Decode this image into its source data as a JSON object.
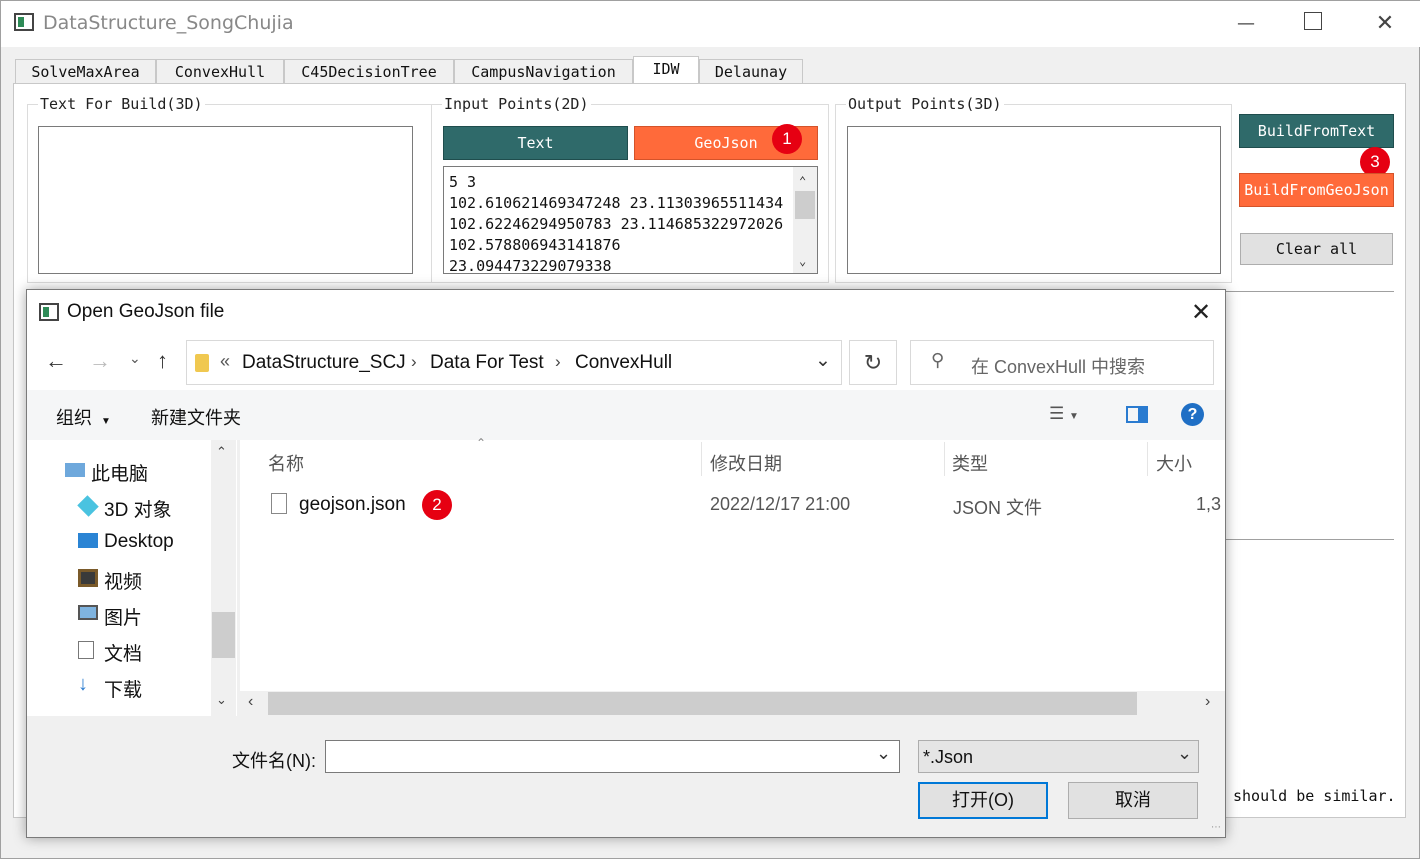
{
  "app": {
    "title": "DataStructure_SongChujia"
  },
  "tabs": [
    "SolveMaxArea",
    "ConvexHull",
    "C45DecisionTree",
    "CampusNavigation",
    "IDW",
    "Delaunay"
  ],
  "groups": {
    "build": "Text For Build(3D)",
    "input": "Input Points(2D)",
    "output": "Output Points(3D)"
  },
  "buttons": {
    "text": "Text",
    "geojson": "GeoJson",
    "build_text": "BuildFromText",
    "build_geojson": "BuildFromGeoJson",
    "clear_all": "Clear all"
  },
  "input_points": {
    "line1": "5 3",
    "line2": "102.610621469347248 23.11303965511434",
    "line3": "102.62246294950783 23.114685322972026",
    "line4": "102.578806943141876",
    "line5": "23.094473229079338"
  },
  "background_note": "should be similar.",
  "badges": {
    "one": "1",
    "two": "2",
    "three": "3"
  },
  "dialog": {
    "title": "Open GeoJson file",
    "breadcrumb": {
      "prefix": "«",
      "part1": "DataStructure_SCJ",
      "part2": "Data For Test",
      "part3": "ConvexHull"
    },
    "search_placeholder": "在 ConvexHull 中搜索",
    "organize": "组织",
    "new_folder": "新建文件夹",
    "help": "?",
    "nav": [
      "此电脑",
      "3D 对象",
      "Desktop",
      "视频",
      "图片",
      "文档",
      "下载"
    ],
    "columns": {
      "name": "名称",
      "modified": "修改日期",
      "type": "类型",
      "size": "大小"
    },
    "file": {
      "name": "geojson.json",
      "modified": "2022/12/17 21:00",
      "type": "JSON 文件",
      "size": "1,3"
    },
    "filename_label": "文件名(N):",
    "filename_value": "",
    "filter": "*.Json",
    "open": "打开(O)",
    "cancel": "取消"
  },
  "colors": {
    "teal": "#2f6a6a",
    "orange": "#ff6a3a",
    "badge": "#e60012"
  }
}
